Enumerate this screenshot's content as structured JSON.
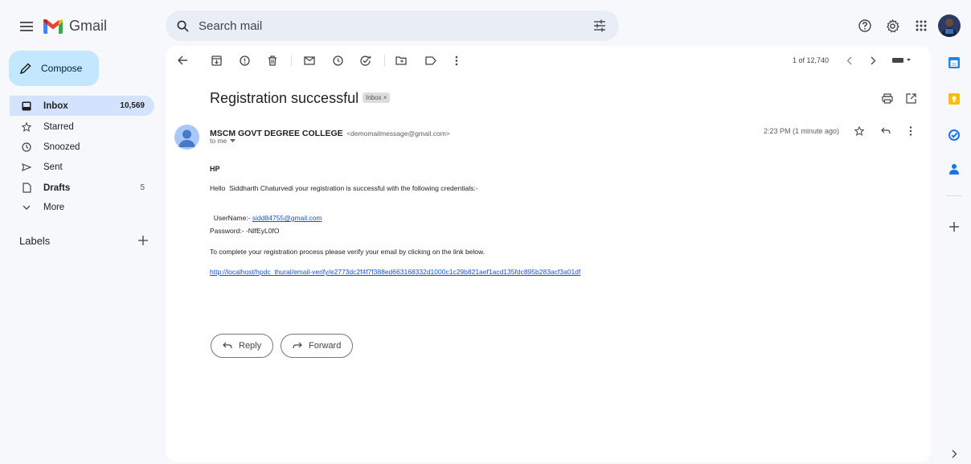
{
  "header": {
    "app_name": "Gmail",
    "search_placeholder": "Search mail"
  },
  "sidebar": {
    "compose_label": "Compose",
    "items": [
      {
        "label": "Inbox",
        "count": "10,569",
        "icon": "inbox-icon"
      },
      {
        "label": "Starred",
        "count": "",
        "icon": "star-icon"
      },
      {
        "label": "Snoozed",
        "count": "",
        "icon": "clock-icon"
      },
      {
        "label": "Sent",
        "count": "",
        "icon": "send-icon"
      },
      {
        "label": "Drafts",
        "count": "5",
        "icon": "file-icon"
      },
      {
        "label": "More",
        "count": "",
        "icon": "chevron-down-icon"
      }
    ],
    "labels_heading": "Labels"
  },
  "toolbar": {
    "pagination": "1 of 12,740"
  },
  "message": {
    "subject": "Registration successful",
    "label_chip": "Inbox ×",
    "sender_name": "MSCM GOVT DEGREE COLLEGE",
    "sender_email": "<demomailmessage@gmail.com>",
    "recipient": "to me",
    "time": "2:23 PM (1 minute ago)",
    "body": {
      "heading": "HP",
      "greeting": "Hello  Siddharth Chaturvedi your registration is successful with the following credentials:-",
      "username_label": "UserName:- ",
      "username_value": "sidd84755@gmail.com",
      "password_line": "Password:- -NlfEyL0fO",
      "instruction": "To complete your registration process please verify your email by clicking on the link below.",
      "verify_link": "http://localhost/hpdc_thural/email-verify/e2773dc2f4f7f388ed663168332d1000c1c29b821aef1acd135fdc895b283acf3a01df"
    }
  },
  "actions": {
    "reply_label": "Reply",
    "forward_label": "Forward"
  },
  "colors": {
    "background": "#f6f8fc",
    "compose": "#c2e7ff",
    "active_nav": "#d3e3fd",
    "link": "#1155cc"
  }
}
